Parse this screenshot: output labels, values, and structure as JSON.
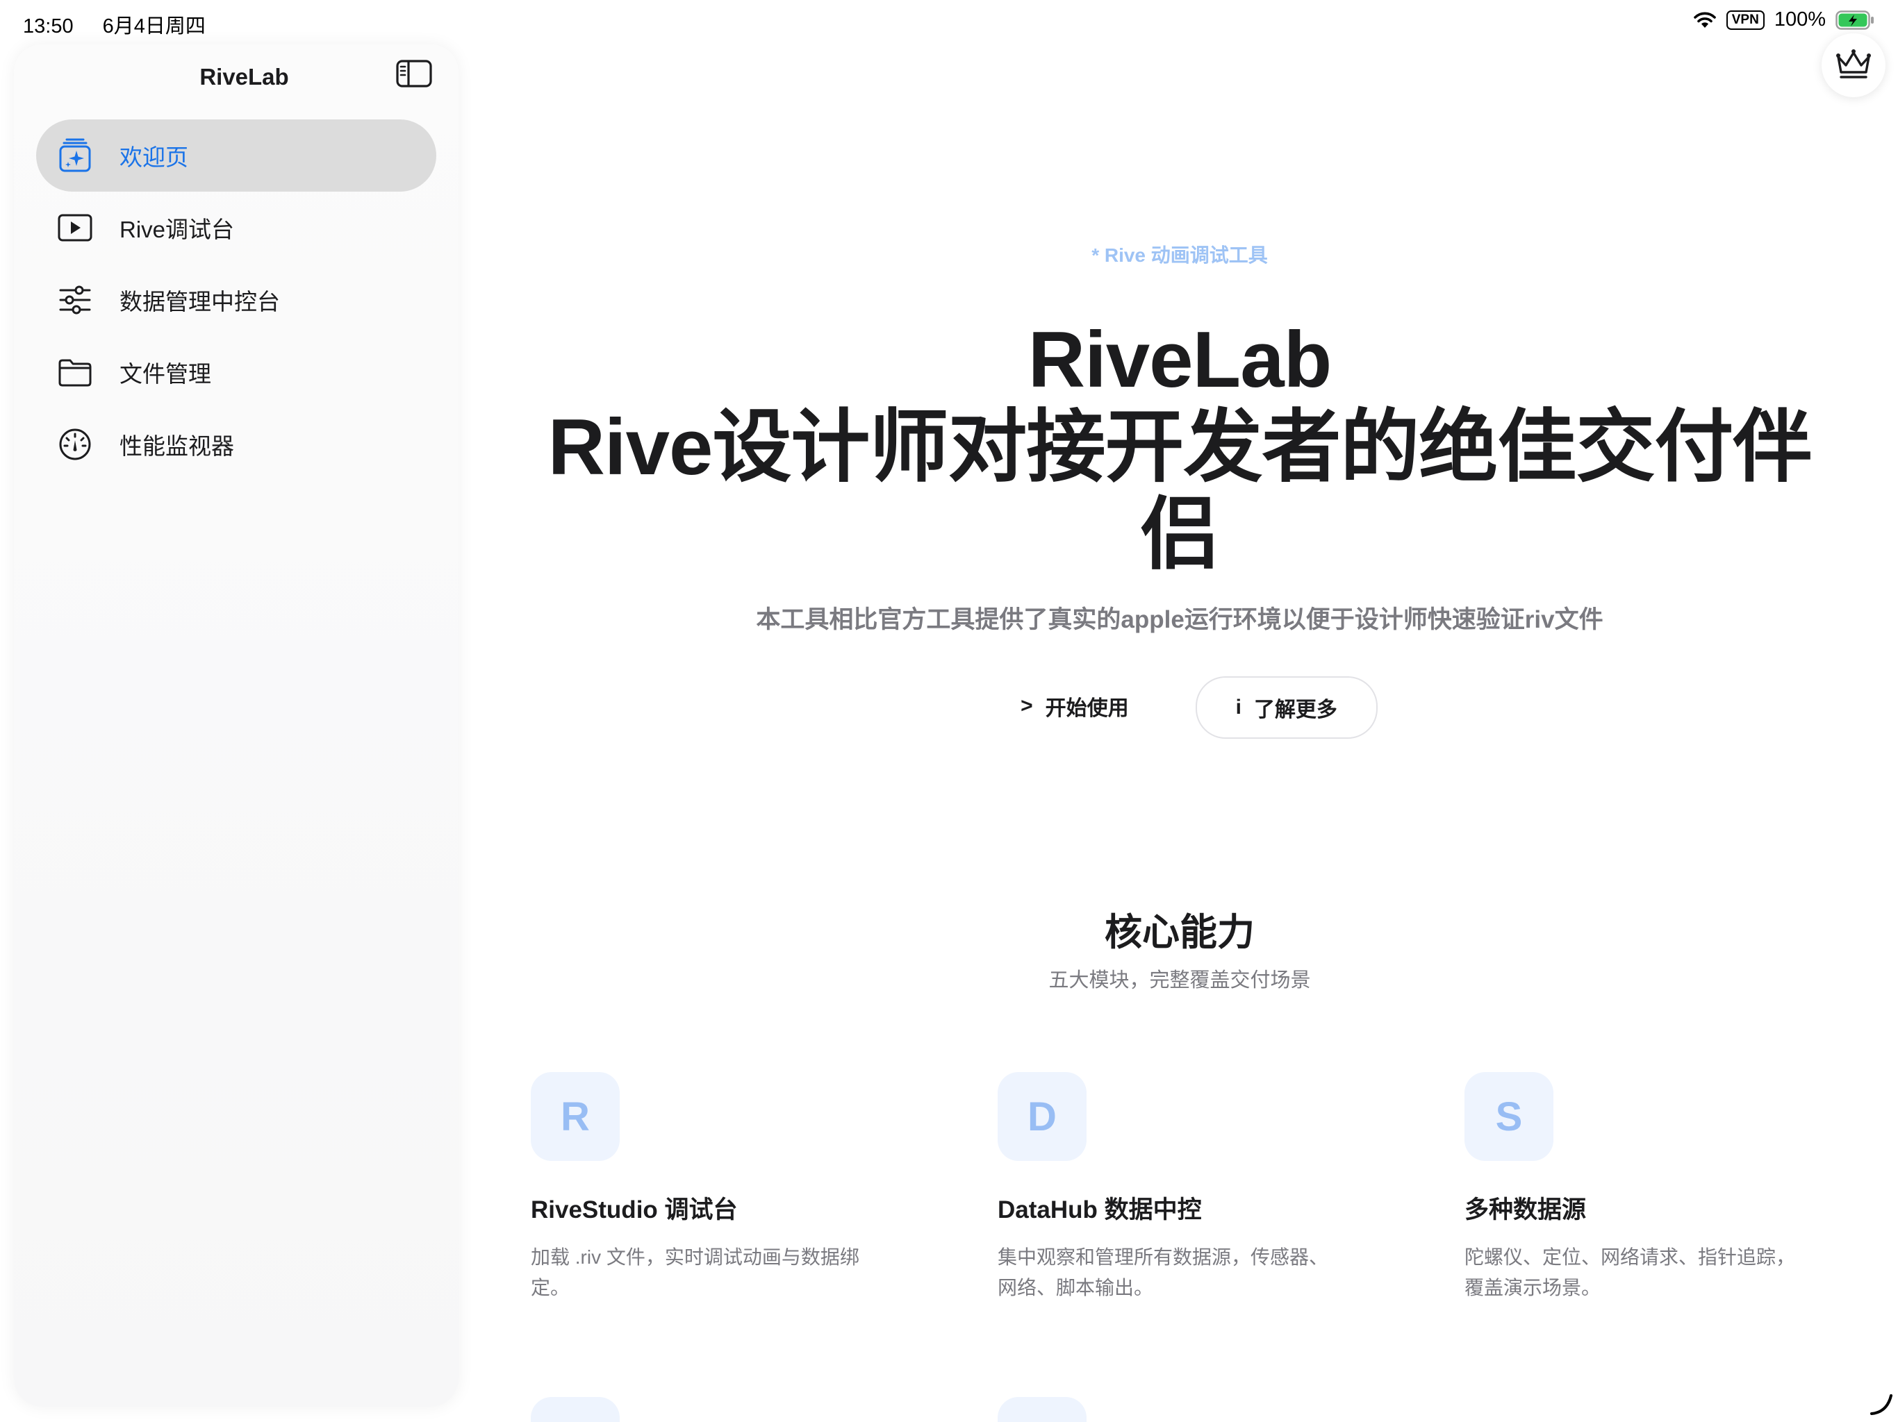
{
  "status_bar": {
    "time": "13:50",
    "date": "6月4日周四",
    "vpn": "VPN",
    "battery": "100%",
    "battery_color": "#34c759"
  },
  "sidebar": {
    "title": "RiveLab",
    "toggle_icon": "sidebar-toggle-icon",
    "items": [
      {
        "label": "欢迎页",
        "icon": "welcome-sparkle-icon",
        "active": true
      },
      {
        "label": "Rive调试台",
        "icon": "play-rectangle-icon",
        "active": false
      },
      {
        "label": "数据管理中控台",
        "icon": "sliders-icon",
        "active": false
      },
      {
        "label": "文件管理",
        "icon": "folder-icon",
        "active": false
      },
      {
        "label": "性能监视器",
        "icon": "gauge-icon",
        "active": false
      }
    ]
  },
  "top_right": {
    "icon": "crown-icon"
  },
  "hero": {
    "eyebrow": "* Rive 动画调试工具",
    "title_line1": "RiveLab",
    "title_line2": "Rive设计师对接开发者的绝佳交付伴侣",
    "subtitle": "本工具相比官方工具提供了真实的apple运行环境以便于设计师快速验证riv文件",
    "primary_glyph": ">",
    "primary_label": "开始使用",
    "secondary_glyph": "i",
    "secondary_label": "了解更多"
  },
  "features": {
    "title": "核心能力",
    "subtitle": "五大模块，完整覆盖交付场景",
    "cards": [
      {
        "letter": "R",
        "title": "RiveStudio 调试台",
        "desc": "加载 .riv 文件，实时调试动画与数据绑定。"
      },
      {
        "letter": "D",
        "title": "DataHub 数据中控",
        "desc": "集中观察和管理所有数据源，传感器、网络、脚本输出。"
      },
      {
        "letter": "S",
        "title": "多种数据源",
        "desc": "陀螺仪、定位、网络请求、指针追踪，覆盖演示场景。"
      }
    ]
  },
  "colors": {
    "accent": "#1a73e8",
    "active_bg": "#dcdcdc",
    "eyebrow": "#9ec3f5",
    "badge_bg": "#eef4fe",
    "badge_text": "#98bdf4",
    "muted_text": "#7a7a80"
  }
}
